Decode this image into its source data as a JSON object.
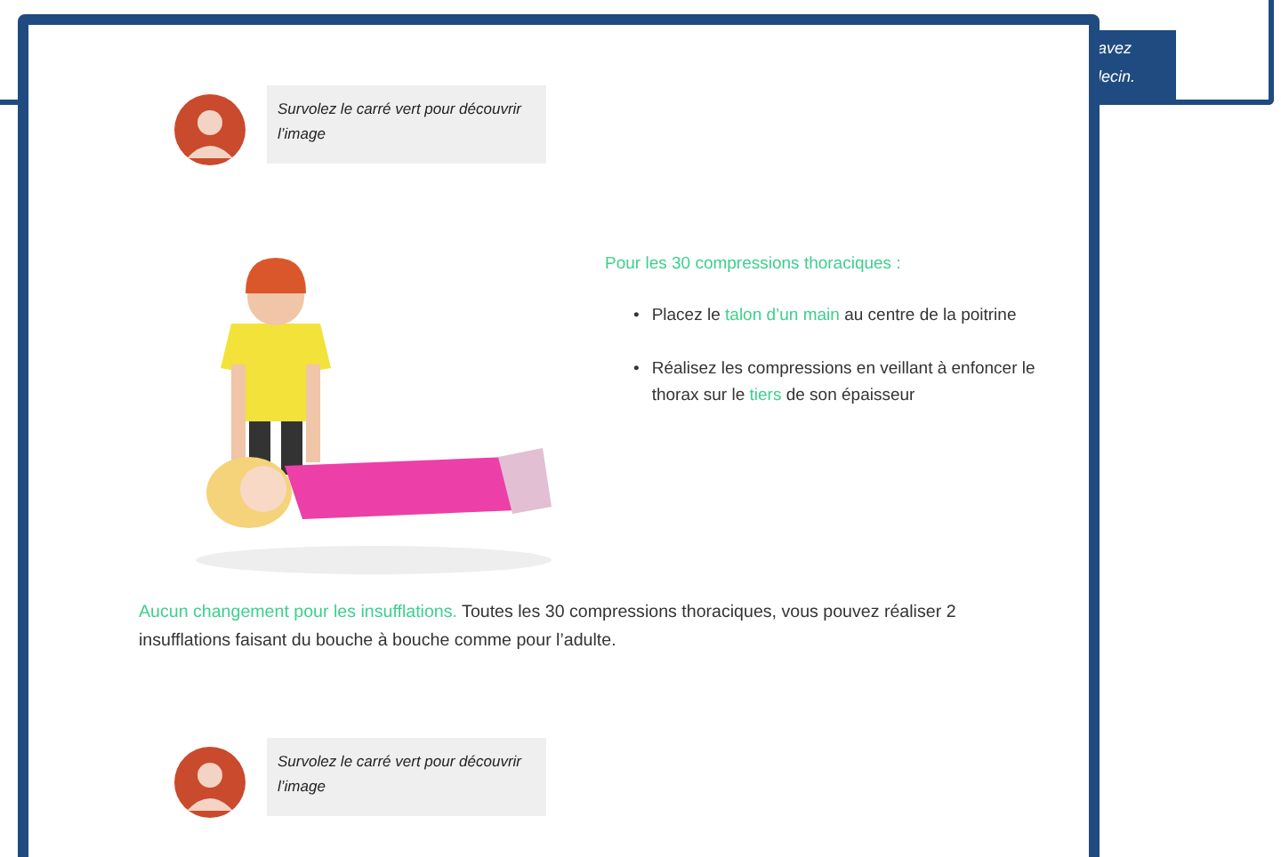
{
  "background_panel": {
    "lines": [
      "avez",
      "lecin."
    ]
  },
  "tips": [
    {
      "text": "Survolez le carré vert pour découvrir l’image"
    }
  ],
  "instructions": {
    "heading": "Pour les 30 compressions thoraciques :",
    "marker": "•",
    "bullets": [
      [
        {
          "text": "Placez le ",
          "highlight": false
        },
        {
          "text": "talon d’un main",
          "highlight": true
        },
        {
          "text": " au centre de la poitrine",
          "highlight": false
        }
      ],
      [
        {
          "text": "Réalisez les compressions en veillant à enfoncer le thorax sur le ",
          "highlight": false
        },
        {
          "text": "tiers",
          "highlight": true
        },
        {
          "text": " de son épaisseur",
          "highlight": false
        }
      ]
    ]
  },
  "paragraph": [
    {
      "text": "Aucun changement pour les insufflations.",
      "highlight": true
    },
    {
      "text": " Toutes les 30 compressions thoraciques, vous pouvez réaliser 2 insufflations faisant du bouche à bouche comme pour l’adulte.",
      "highlight": false
    }
  ],
  "tips_bottom": [
    {
      "text": "Survolez le carré vert pour découvrir l’image"
    }
  ]
}
